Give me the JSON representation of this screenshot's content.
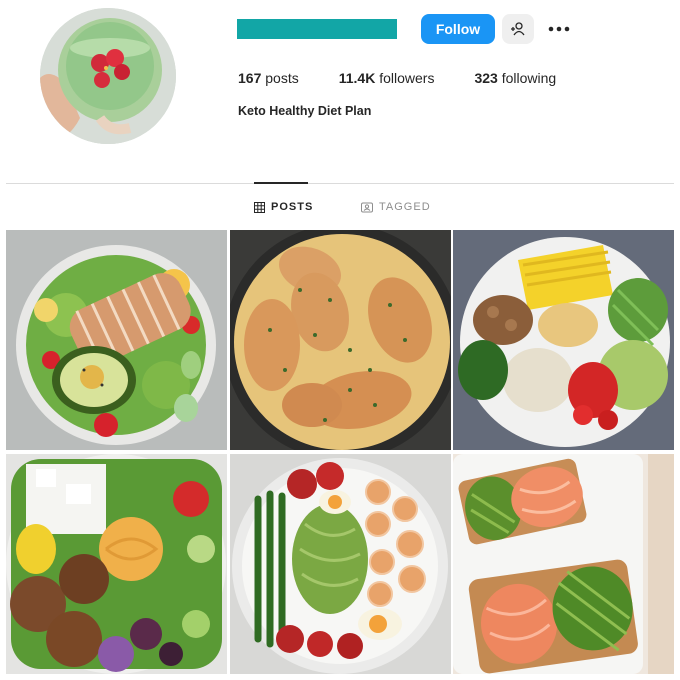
{
  "header": {
    "follow_label": "Follow",
    "add_user_icon": "add-user-icon",
    "more_icon": "more-icon"
  },
  "stats": {
    "posts_count": "167",
    "posts_label": "posts",
    "followers_count": "11.4K",
    "followers_label": "followers",
    "following_count": "323",
    "following_label": "following"
  },
  "bio": {
    "name": "Keto Healthy Diet Plan"
  },
  "tabs": [
    {
      "label": "POSTS",
      "icon": "grid-icon",
      "active": true
    },
    {
      "label": "TAGGED",
      "icon": "tagged-icon",
      "active": false
    }
  ],
  "colors": {
    "accent": "#1a95f5",
    "username_redaction": "#12a6a6"
  },
  "posts": [
    {
      "subject": "chicken avocado salad bowl"
    },
    {
      "subject": "creamy chicken skillet"
    },
    {
      "subject": "quinoa vegetable bowl"
    },
    {
      "subject": "falafel hummus salad"
    },
    {
      "subject": "shrimp asparagus bowl"
    },
    {
      "subject": "salmon avocado toast"
    }
  ]
}
